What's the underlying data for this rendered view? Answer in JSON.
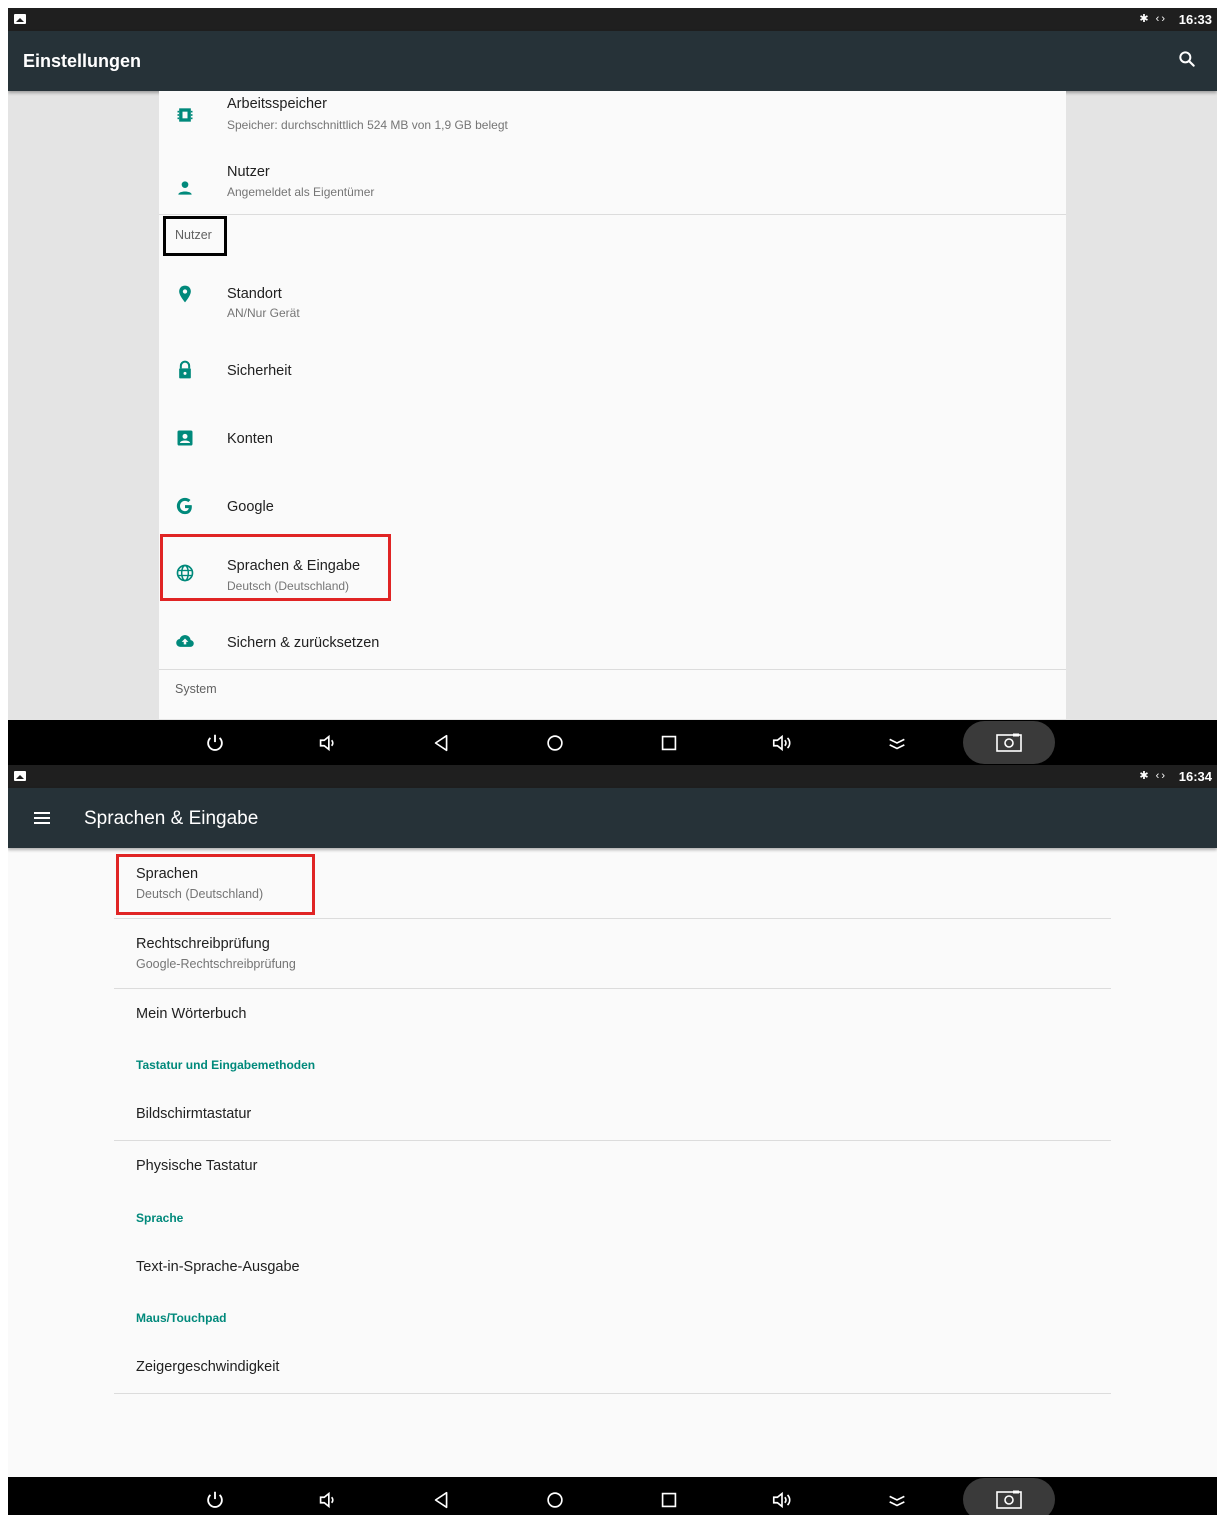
{
  "screen1": {
    "status": {
      "time": "16:33",
      "icons": "✱ ‹›"
    },
    "appbar": {
      "title": "Einstellungen"
    },
    "items": [
      {
        "label": "Arbeitsspeicher",
        "sub": "Speicher: durchschnittlich 524 MB von 1,9 GB belegt",
        "icon": "memory-icon"
      },
      {
        "label": "Nutzer",
        "sub": "Angemeldet als Eigentümer",
        "icon": "person-icon"
      },
      {
        "label": "Standort",
        "sub": "AN/Nur Gerät",
        "icon": "location-icon"
      },
      {
        "label": "Sicherheit",
        "sub": "",
        "icon": "lock-icon"
      },
      {
        "label": "Konten",
        "sub": "",
        "icon": "account-box-icon"
      },
      {
        "label": "Google",
        "sub": "",
        "icon": "google-icon"
      },
      {
        "label": "Sprachen & Eingabe",
        "sub": "Deutsch (Deutschland)",
        "icon": "globe-icon"
      },
      {
        "label": "Sichern & zurücksetzen",
        "sub": "",
        "icon": "cloud-upload-icon"
      }
    ],
    "categories": {
      "nutzer": "Nutzer",
      "system": "System"
    }
  },
  "screen2": {
    "status": {
      "time": "16:34",
      "icons": "✱ ‹›"
    },
    "appbar": {
      "title": "Sprachen & Eingabe"
    },
    "items": [
      {
        "label": "Sprachen",
        "sub": "Deutsch (Deutschland)"
      },
      {
        "label": "Rechtschreibprüfung",
        "sub": "Google-Rechtschreibprüfung"
      },
      {
        "label": "Mein Wörterbuch"
      },
      {
        "label": "Bildschirmtastatur"
      },
      {
        "label": "Physische Tastatur"
      },
      {
        "label": "Text-in-Sprache-Ausgabe"
      },
      {
        "label": "Zeigergeschwindigkeit"
      }
    ],
    "categories": {
      "keyboard": "Tastatur und Eingabemethoden",
      "speech": "Sprache",
      "mouse": "Maus/Touchpad"
    }
  },
  "navbar": {
    "buttons": [
      "power-icon",
      "volume-down-icon",
      "back-icon",
      "home-icon",
      "recents-icon",
      "volume-up-icon",
      "collapse-icon",
      "screenshot-icon"
    ]
  },
  "colors": {
    "appbar": "#263238",
    "accent": "#00897b",
    "highlight": "#e02424"
  }
}
